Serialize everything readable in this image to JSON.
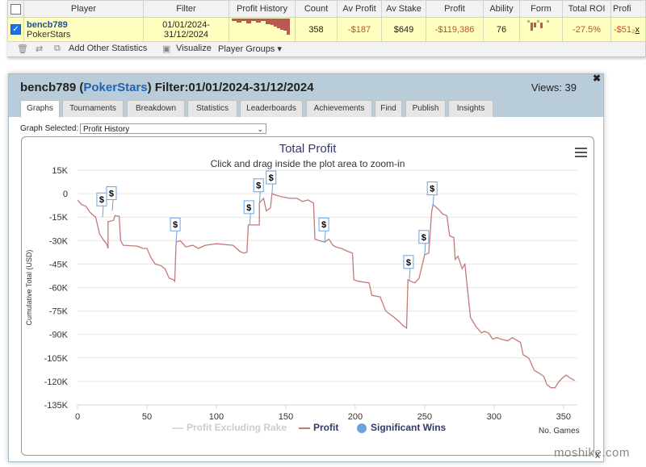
{
  "stats_table": {
    "headers": [
      "",
      "Player",
      "Filter",
      "Profit History",
      "Count",
      "Av Profit",
      "Av Stake",
      "Profit",
      "Ability",
      "Form",
      "Total ROI",
      "Profi"
    ],
    "row": {
      "player_name": "bencb789",
      "player_site": "PokerStars",
      "filter_line1": "01/01/2024-",
      "filter_line2": "31/12/2024",
      "count": "358",
      "av_profit": "-$187",
      "av_stake": "$649",
      "profit": "-$119,386",
      "ability": "76",
      "total_roi": "-27.5%",
      "profi": "-$51₂",
      "remove": "x"
    }
  },
  "toolbar": {
    "add_stats": "Add Other Statistics",
    "visualize": "Visualize",
    "player_groups": "Player Groups ▾"
  },
  "modal": {
    "player": "bencb789",
    "site": "PokerStars",
    "filter": "Filter:01/01/2024-31/12/2024",
    "views": "Views: 39",
    "close": "✖",
    "tabs": [
      "Graphs",
      "Tournaments",
      "Breakdown",
      "Statistics",
      "Leaderboards",
      "Achievements",
      "Find",
      "Publish",
      "Insights"
    ],
    "graph_selected_label": "Graph Selected:",
    "graph_selected_value": "Profit History"
  },
  "chart_data": {
    "type": "line",
    "title": "Total Profit",
    "subtitle": "Click and drag inside the plot area to zoom-in",
    "ylabel": "Cumulative Total (USD)",
    "xlabel": "No. Games",
    "xlim": [
      0,
      360
    ],
    "ylim": [
      -135000,
      15000
    ],
    "x_ticks": [
      0,
      50,
      100,
      150,
      200,
      250,
      300,
      350
    ],
    "y_ticks": [
      15000,
      0,
      -15000,
      -30000,
      -45000,
      -60000,
      -75000,
      -90000,
      -105000,
      -120000,
      -135000
    ],
    "y_tick_labels": [
      "15K",
      "0",
      "-15K",
      "-30K",
      "-45K",
      "-60K",
      "-75K",
      "-90K",
      "-105K",
      "-120K",
      "-135K"
    ],
    "legend": [
      "Profit Excluding Rake",
      "Profit",
      "Significant Wins"
    ],
    "series": [
      {
        "name": "Profit",
        "color": "#c47a78",
        "points": [
          [
            0,
            -4000
          ],
          [
            3,
            -7000
          ],
          [
            6,
            -8000
          ],
          [
            9,
            -12000
          ],
          [
            13,
            -15000
          ],
          [
            16,
            -26000
          ],
          [
            19,
            -30000
          ],
          [
            21,
            -32000
          ],
          [
            22,
            -35000
          ],
          [
            22,
            -18000
          ],
          [
            26,
            -17000
          ],
          [
            27,
            -14000
          ],
          [
            30,
            -14500
          ],
          [
            31,
            -30000
          ],
          [
            33,
            -33000
          ],
          [
            43,
            -33500
          ],
          [
            47,
            -35000
          ],
          [
            50,
            -35000
          ],
          [
            53,
            -41000
          ],
          [
            56,
            -45000
          ],
          [
            60,
            -46000
          ],
          [
            63,
            -48000
          ],
          [
            66,
            -54000
          ],
          [
            69,
            -55000
          ],
          [
            70,
            -56000
          ],
          [
            71,
            -31000
          ],
          [
            74,
            -30000
          ],
          [
            78,
            -34000
          ],
          [
            83,
            -33000
          ],
          [
            87,
            -35000
          ],
          [
            92,
            -33000
          ],
          [
            100,
            -32000
          ],
          [
            112,
            -33000
          ],
          [
            117,
            -37000
          ],
          [
            120,
            -38000
          ],
          [
            122,
            -37500
          ],
          [
            123,
            -20000
          ],
          [
            126,
            -20000
          ],
          [
            131,
            -20000
          ],
          [
            131,
            -6000
          ],
          [
            134,
            -3000
          ],
          [
            136,
            -11000
          ],
          [
            139,
            -9000
          ],
          [
            140,
            0
          ],
          [
            143,
            -1000
          ],
          [
            147,
            -2000
          ],
          [
            153,
            -3000
          ],
          [
            158,
            -3000
          ],
          [
            162,
            -5000
          ],
          [
            166,
            -4000
          ],
          [
            170,
            -6000
          ],
          [
            171,
            -29000
          ],
          [
            174,
            -30000
          ],
          [
            178,
            -31000
          ],
          [
            181,
            -29000
          ],
          [
            184,
            -33000
          ],
          [
            186,
            -34000
          ],
          [
            190,
            -35000
          ],
          [
            195,
            -37000
          ],
          [
            198,
            -38000
          ],
          [
            199,
            -55000
          ],
          [
            202,
            -56000
          ],
          [
            210,
            -57000
          ],
          [
            212,
            -65000
          ],
          [
            218,
            -66000
          ],
          [
            222,
            -75000
          ],
          [
            228,
            -79000
          ],
          [
            232,
            -82000
          ],
          [
            234,
            -84000
          ],
          [
            237,
            -86000
          ],
          [
            238,
            -55000
          ],
          [
            240,
            -56000
          ],
          [
            243,
            -57000
          ],
          [
            246,
            -54000
          ],
          [
            250,
            -39000
          ],
          [
            253,
            -38000
          ],
          [
            255,
            -12000
          ],
          [
            256,
            -7000
          ],
          [
            260,
            -10000
          ],
          [
            263,
            -13000
          ],
          [
            266,
            -14000
          ],
          [
            268,
            -27000
          ],
          [
            271,
            -28000
          ],
          [
            272,
            -42000
          ],
          [
            274,
            -40000
          ],
          [
            277,
            -48000
          ],
          [
            279,
            -45000
          ],
          [
            283,
            -79000
          ],
          [
            287,
            -85000
          ],
          [
            291,
            -89000
          ],
          [
            293,
            -88000
          ],
          [
            296,
            -89000
          ],
          [
            299,
            -93000
          ],
          [
            302,
            -92000
          ],
          [
            305,
            -93000
          ],
          [
            310,
            -94000
          ],
          [
            313,
            -92000
          ],
          [
            317,
            -94000
          ],
          [
            319,
            -95000
          ],
          [
            321,
            -103000
          ],
          [
            325,
            -105000
          ],
          [
            329,
            -113000
          ],
          [
            333,
            -115000
          ],
          [
            336,
            -117000
          ],
          [
            338,
            -122000
          ],
          [
            341,
            -124000
          ],
          [
            344,
            -124000
          ],
          [
            346,
            -121000
          ],
          [
            349,
            -118000
          ],
          [
            352,
            -116000
          ],
          [
            355,
            -118000
          ],
          [
            358,
            -119386
          ]
        ]
      }
    ],
    "significant_wins": [
      {
        "x": 18,
        "y": -15000,
        "label": "$"
      },
      {
        "x": 25,
        "y": -11000,
        "label": "$"
      },
      {
        "x": 71,
        "y": -31000,
        "label": "$"
      },
      {
        "x": 124,
        "y": -20000,
        "label": "$"
      },
      {
        "x": 131,
        "y": -6000,
        "label": "$"
      },
      {
        "x": 140,
        "y": -1000,
        "label": "$"
      },
      {
        "x": 178,
        "y": -31000,
        "label": "$"
      },
      {
        "x": 239,
        "y": -55000,
        "label": "$"
      },
      {
        "x": 250,
        "y": -39000,
        "label": "$"
      },
      {
        "x": 256,
        "y": -8000,
        "label": "$"
      }
    ]
  },
  "watermark": "moshike.com",
  "bg_close": "x"
}
